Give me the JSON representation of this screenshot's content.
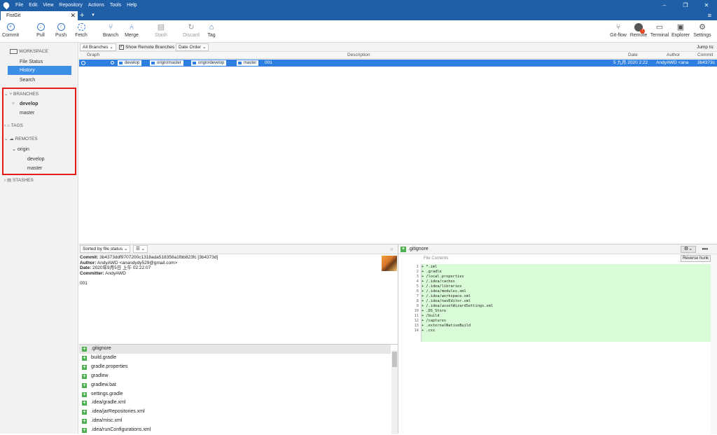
{
  "menubar": {
    "items": [
      "File",
      "Edit",
      "View",
      "Repository",
      "Actions",
      "Tools",
      "Help"
    ],
    "window_controls": [
      "–",
      "❐",
      "✕"
    ]
  },
  "tabs": {
    "active": "FistGit",
    "close": "✕",
    "add": "+",
    "dropdown": "▼",
    "menu": "≡"
  },
  "toolbar": {
    "left": [
      {
        "label": "Commit"
      },
      {
        "label": "Pull"
      },
      {
        "label": "Push"
      },
      {
        "label": "Fetch"
      },
      {
        "label": "Branch"
      },
      {
        "label": "Merge"
      },
      {
        "label": "Stash"
      },
      {
        "label": "Discard"
      },
      {
        "label": "Tag"
      }
    ],
    "right": [
      {
        "label": "Git-flow"
      },
      {
        "label": "Remote"
      },
      {
        "label": "Terminal"
      },
      {
        "label": "Explorer"
      },
      {
        "label": "Settings"
      }
    ],
    "remote_badge": "!"
  },
  "sidebar": {
    "workspace": "WORKSPACE",
    "workspace_items": [
      "File Status",
      "History",
      "Search"
    ],
    "branches": "BRANCHES",
    "branch_items": [
      "develop",
      "master"
    ],
    "tags": "TAGS",
    "remotes": "REMOTES",
    "remote_name": "origin",
    "remote_items": [
      "develop",
      "master"
    ],
    "stashes": "STASHES"
  },
  "filterbar": {
    "branches_select": "All Branches",
    "show_remote_label": "Show Remote Branches",
    "order_select": "Date Order",
    "jump_to": "Jump to:"
  },
  "history": {
    "columns": [
      "Graph",
      "Description",
      "Date",
      "Author",
      "Commit"
    ],
    "row": {
      "tags": [
        "develop",
        "origin/master",
        "origin/develop",
        "master"
      ],
      "message": "001",
      "date": "5 九月 2020 2:22",
      "author": "AndyAWD <ana",
      "commit": "3b4373c"
    }
  },
  "details": {
    "sort_select": "Sorted by file status",
    "list_mode": "☰",
    "commit_label": "Commit:",
    "commit_value": "3b4373ddf9707200c1318ada518358a1fbb823fc [3b4373d]",
    "author_label": "Author:",
    "author_value": "AndyAWD <anandydy529@gmail.com>",
    "date_label": "Date:",
    "date_value": "2020年9月5日 上午 02:22:07",
    "committer_label": "Committer:",
    "committer_value": "AndyAWD",
    "message": "001"
  },
  "files": [
    ".gitignore",
    "build.gradle",
    "gradle.properties",
    "gradlew",
    "gradlew.bat",
    "settings.gradle",
    ".idea/gradle.xml",
    ".idea/jarRepositories.xml",
    ".idea/misc.xml",
    ".idea/runConfigurations.xml"
  ],
  "diff": {
    "file": ".gitignore",
    "header": "File Contents",
    "reverse_hunk": "Reverse hunk",
    "more": "•••",
    "lines": [
      {
        "n": "1",
        "t": "+ *.iml"
      },
      {
        "n": "2",
        "t": "+ .gradle"
      },
      {
        "n": "3",
        "t": "+ /local.properties"
      },
      {
        "n": "4",
        "t": "+ /.idea/caches"
      },
      {
        "n": "5",
        "t": "+ /.idea/libraries"
      },
      {
        "n": "6",
        "t": "+ /.idea/modules.xml"
      },
      {
        "n": "7",
        "t": "+ /.idea/workspace.xml"
      },
      {
        "n": "8",
        "t": "+ /.idea/navEditor.xml"
      },
      {
        "n": "9",
        "t": "+ /.idea/assetWizardSettings.xml"
      },
      {
        "n": "10",
        "t": "+ .DS_Store"
      },
      {
        "n": "11",
        "t": "+ /build"
      },
      {
        "n": "12",
        "t": "+ /captures"
      },
      {
        "n": "13",
        "t": "+ .externalNativeBuild"
      },
      {
        "n": "14",
        "t": "+ .cxx"
      }
    ]
  }
}
